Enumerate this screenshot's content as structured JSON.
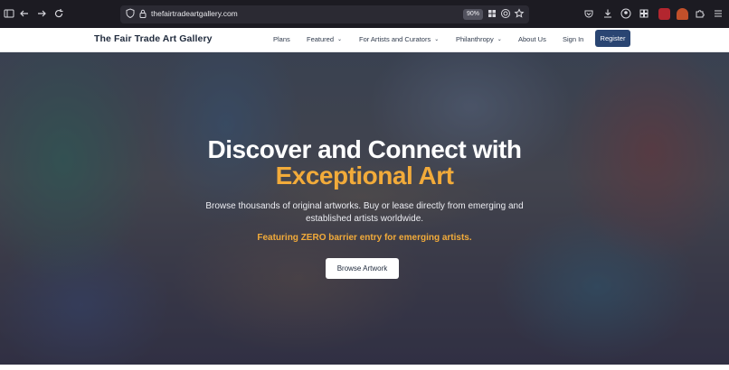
{
  "browser": {
    "url": "thefairtradeartgallery.com",
    "zoom": "90%",
    "icons": [
      "sidebar-icon",
      "back-icon",
      "forward-icon",
      "reload-icon",
      "shield-icon",
      "lock-icon",
      "extensions-grid-icon",
      "fingerprint-icon",
      "bookmark-star-icon",
      "pocket-icon",
      "download-icon",
      "account-icon",
      "grid-icon",
      "extension-icon",
      "extension-icon",
      "puzzle-icon",
      "menu-icon"
    ]
  },
  "header": {
    "brand": "The Fair Trade Art Gallery",
    "nav": [
      {
        "label": "Plans",
        "dropdown": false
      },
      {
        "label": "Featured",
        "dropdown": true
      },
      {
        "label": "For Artists and Curators",
        "dropdown": true
      },
      {
        "label": "Philanthropy",
        "dropdown": true
      },
      {
        "label": "About Us",
        "dropdown": false
      },
      {
        "label": "Sign In",
        "dropdown": false
      }
    ],
    "register": "Register"
  },
  "hero": {
    "title": "Discover and Connect with",
    "title_accent": "Exceptional Art",
    "subtitle": "Browse thousands of original artworks. Buy or lease directly from emerging and established artists worldwide.",
    "highlight": "Featuring ZERO barrier entry for emerging artists.",
    "cta": "Browse Artwork"
  },
  "colors": {
    "brand_navy": "#2a4572",
    "accent_gold": "#f2ab3a",
    "browser_bg": "#1c1b22"
  }
}
